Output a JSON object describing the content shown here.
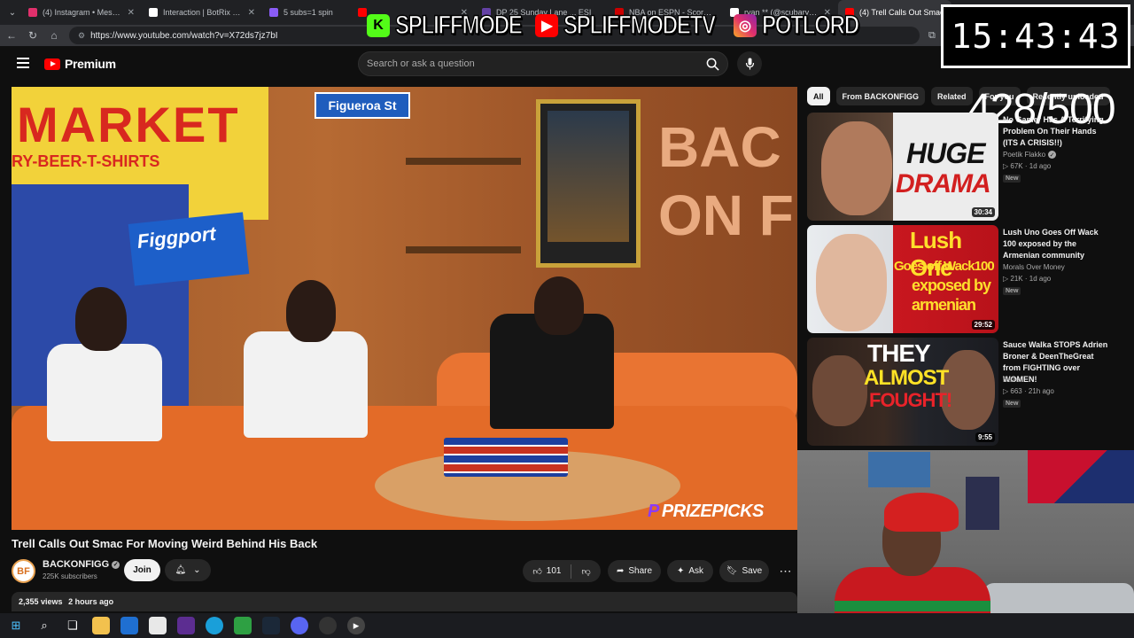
{
  "browser": {
    "tabs": [
      {
        "title": "(4) Instagram • Messages",
        "favicon_color": "#e1306c",
        "icon": "instagram-icon",
        "active": false
      },
      {
        "title": "Interaction | BotRix — Cloud",
        "favicon_color": "#ffffff",
        "icon": "botrix-icon",
        "active": false
      },
      {
        "title": "5 subs=1 spin",
        "favicon_color": "#8a5cf6",
        "icon": "spin-icon",
        "active": false
      },
      {
        "title": "",
        "favicon_color": "#ff0000",
        "icon": "youtube-icon",
        "active": false
      },
      {
        "title": "DP 25 Sunday Lane ... ESI",
        "favicon_color": "#6441a5",
        "icon": "twitch-icon",
        "active": false
      },
      {
        "title": "NBA on ESPN - Scores, Stats",
        "favicon_color": "#cc0000",
        "icon": "espn-icon",
        "active": false
      },
      {
        "title": "ryan ** (@scubaryan_) / X",
        "favicon_color": "#ffffff",
        "icon": "x-icon",
        "active": false
      },
      {
        "title": "(4) Trell Calls Out Smac",
        "favicon_color": "#ff0000",
        "icon": "youtube-icon",
        "active": true
      }
    ],
    "url": "https://www.youtube.com/watch?v=X72ds7jz7bI"
  },
  "overlay": {
    "brand_1": "SPLIFFMODE",
    "brand_2": "SPLIFFMODETV",
    "brand_3": "POTLORD",
    "clock": "15:43:43",
    "counter": "428/500"
  },
  "youtube": {
    "logo_text": "Premium",
    "search_placeholder": "Search or ask a question",
    "video": {
      "title": "Trell Calls Out Smac For Moving Weird Behind His Back",
      "channel": "BACKONFIGG",
      "channel_avatar": "BF",
      "subscribers": "225K subscribers",
      "join_label": "Join",
      "likes": "101",
      "share_label": "Share",
      "ask_label": "Ask",
      "save_label": "Save",
      "views": "2,355 views",
      "posted": "2 hours ago",
      "scene_text": {
        "market": "MARKET",
        "market_sub": "RY-BEER-T-SHIRTS",
        "figgport": "Figgport",
        "street": "Figueroa St",
        "back": "BAC",
        "on": "ON F",
        "sponsor": "PRIZEPICKS"
      }
    },
    "chips": [
      "All",
      "From BACKONFIGG",
      "Related",
      "For you",
      "Recently uploaded"
    ],
    "recommendations": [
      {
        "title": "No Gamer Has A Terrifying Problem On Their Hands (ITS A CRISIS!!)",
        "channel": "Poetik Flakko",
        "verified": true,
        "views": "67K",
        "age": "1d ago",
        "badge": "New",
        "duration": "30:34",
        "thumb_text_1": "HUGE",
        "thumb_text_2": "DRAMA"
      },
      {
        "title": "Lush Uno Goes Off Wack 100 exposed by the Armenian community",
        "channel": "Morals Over Money",
        "verified": false,
        "views": "21K",
        "age": "1d ago",
        "badge": "New",
        "duration": "29:52",
        "thumb_text_1": "Lush One",
        "thumb_text_2": "Goes off Wack100",
        "thumb_text_3": "exposed by",
        "thumb_text_4": "armenian"
      },
      {
        "title": "Sauce Walka STOPS Adrien Broner & DeenTheGreat from FIGHTING over WOMEN!",
        "channel": "Daze",
        "verified": false,
        "views": "663",
        "age": "21h ago",
        "badge": "New",
        "duration": "9:55",
        "thumb_text_1": "THEY",
        "thumb_text_2": "ALMOST",
        "thumb_text_3": "FOUGHT!"
      }
    ]
  },
  "colors": {
    "youtube_red": "#ff0000",
    "background": "#0f0f0f",
    "chip_bg": "#272727",
    "text": "#f1f1f1",
    "secondary_text": "#aaaaaa"
  }
}
